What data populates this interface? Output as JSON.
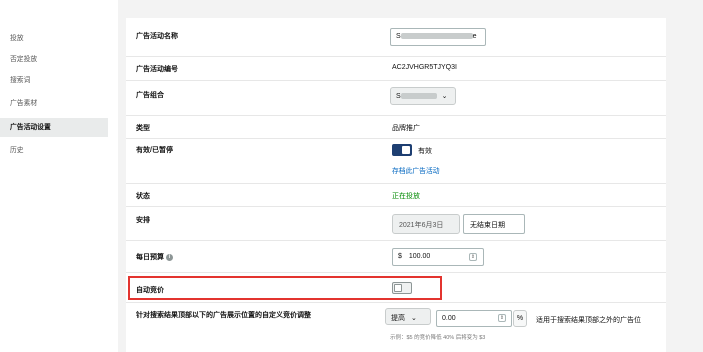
{
  "sidebar": {
    "items": [
      {
        "label": "投放"
      },
      {
        "label": "否定投放"
      },
      {
        "label": "搜索词"
      },
      {
        "label": "广告素材"
      },
      {
        "label": "广告活动设置"
      },
      {
        "label": "历史"
      }
    ],
    "active_index": 4
  },
  "settings": {
    "campaign_name": {
      "label": "广告活动名称",
      "value_start": "S",
      "value_end": "e"
    },
    "campaign_id": {
      "label": "广告活动编号",
      "value": "AC2JVHGR5TJYQ3I"
    },
    "portfolio": {
      "label": "广告组合",
      "value_start": "S",
      "chevron": "⌄"
    },
    "type": {
      "label": "类型",
      "value": "品牌推广"
    },
    "active_paused": {
      "label": "有效/已暂停",
      "toggle_label": "有效",
      "toggle_on": true,
      "archive_link": "存档此广告活动"
    },
    "status": {
      "label": "状态",
      "value": "正在投放",
      "color": "#008a00"
    },
    "schedule": {
      "label": "安排",
      "start_date": "2021年6月3日",
      "end_date": "无结束日期"
    },
    "daily_budget": {
      "label": "每日预算",
      "info_icon": "info-icon",
      "currency": "$",
      "value": "100.00"
    },
    "auto_bidding": {
      "label": "自动竞价",
      "toggle_on": false
    },
    "bid_adjustment": {
      "label": "针对搜索结果顶部以下的广告展示位置的自定义竞价调整",
      "direction": "提高",
      "direction_chevron": "⌄",
      "value": "0.00",
      "unit": "%",
      "description": "适用于搜索结果顶部之外的广告位",
      "example": "示例：$5 的竞价降低 40% 后将变为 $3"
    }
  },
  "colors": {
    "toggle_on": "#1e3f72",
    "link": "#0066c0",
    "highlight_border": "#e3342f"
  }
}
